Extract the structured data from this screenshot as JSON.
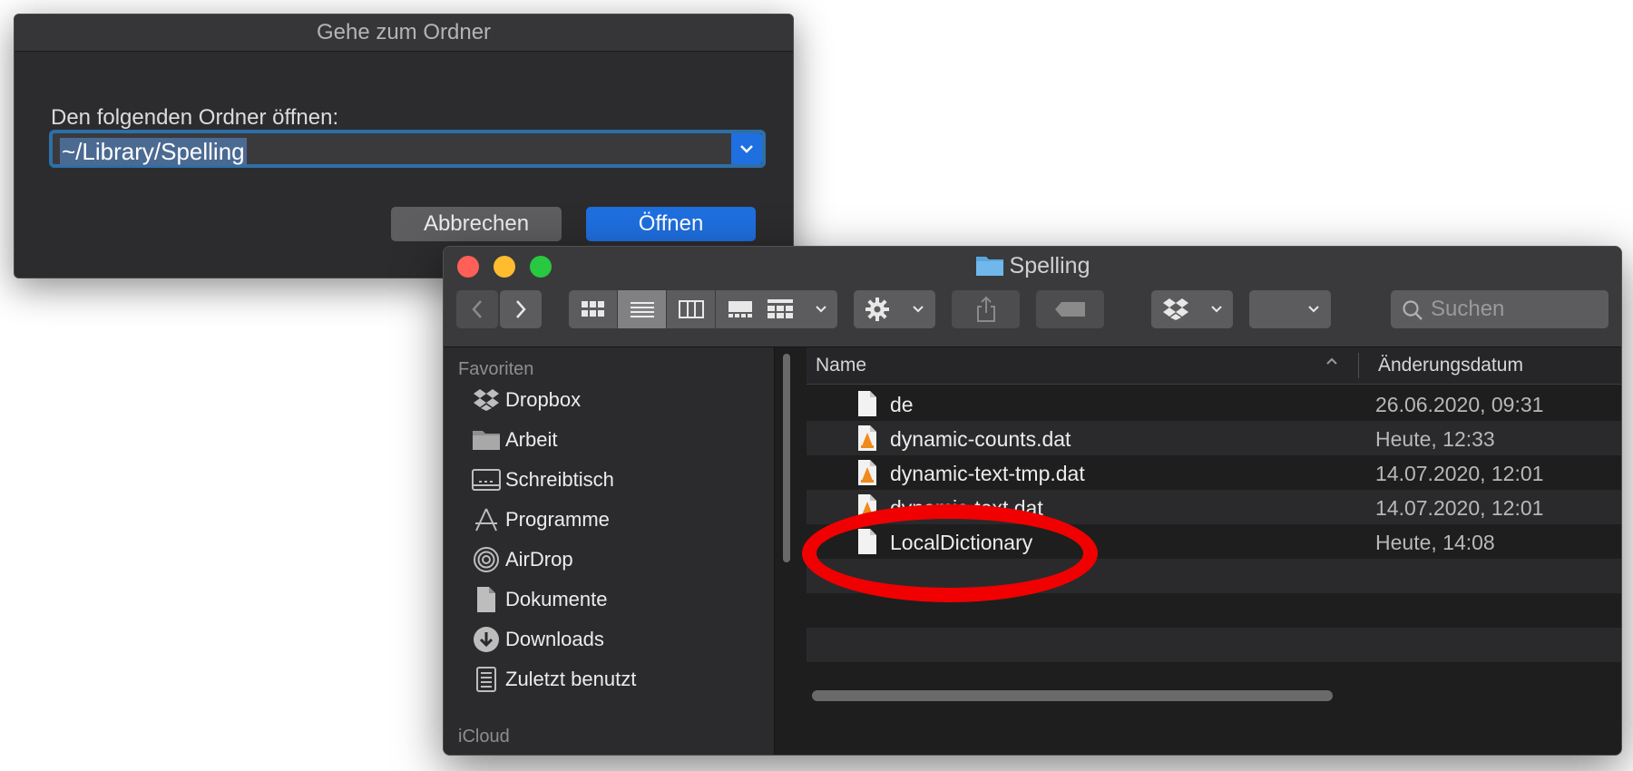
{
  "dialog": {
    "title": "Gehe zum Ordner",
    "prompt": "Den folgenden Ordner öffnen:",
    "path_value": "~/Library/Spelling",
    "cancel_label": "Abbrechen",
    "open_label": "Öffnen"
  },
  "finder": {
    "title": "Spelling",
    "search_placeholder": "Suchen",
    "sidebar": {
      "section_favorites": "Favoriten",
      "items": [
        {
          "label": "Dropbox",
          "icon": "dropbox-icon"
        },
        {
          "label": "Arbeit",
          "icon": "folder-icon"
        },
        {
          "label": "Schreibtisch",
          "icon": "desktop-icon"
        },
        {
          "label": "Programme",
          "icon": "applications-icon"
        },
        {
          "label": "AirDrop",
          "icon": "airdrop-icon"
        },
        {
          "label": "Dokumente",
          "icon": "documents-icon"
        },
        {
          "label": "Downloads",
          "icon": "downloads-icon"
        },
        {
          "label": "Zuletzt benutzt",
          "icon": "recents-icon"
        }
      ],
      "section_icloud": "iCloud"
    },
    "columns": {
      "name": "Name",
      "date": "Änderungsdatum"
    },
    "files": [
      {
        "name": "de",
        "date": "26.06.2020, 09:31",
        "icon": "document-icon"
      },
      {
        "name": "dynamic-counts.dat",
        "date": "Heute, 12:33",
        "icon": "vlc-file-icon"
      },
      {
        "name": "dynamic-text-tmp.dat",
        "date": "14.07.2020, 12:01",
        "icon": "vlc-file-icon"
      },
      {
        "name": "dynamic-text.dat",
        "date": "14.07.2020, 12:01",
        "icon": "vlc-file-icon"
      },
      {
        "name": "LocalDictionary",
        "date": "Heute, 14:08",
        "icon": "document-icon"
      }
    ]
  },
  "colors": {
    "accent_blue": "#1f6fe0",
    "highlight_red": "#f00000",
    "window_bg": "#1e1e1e"
  }
}
